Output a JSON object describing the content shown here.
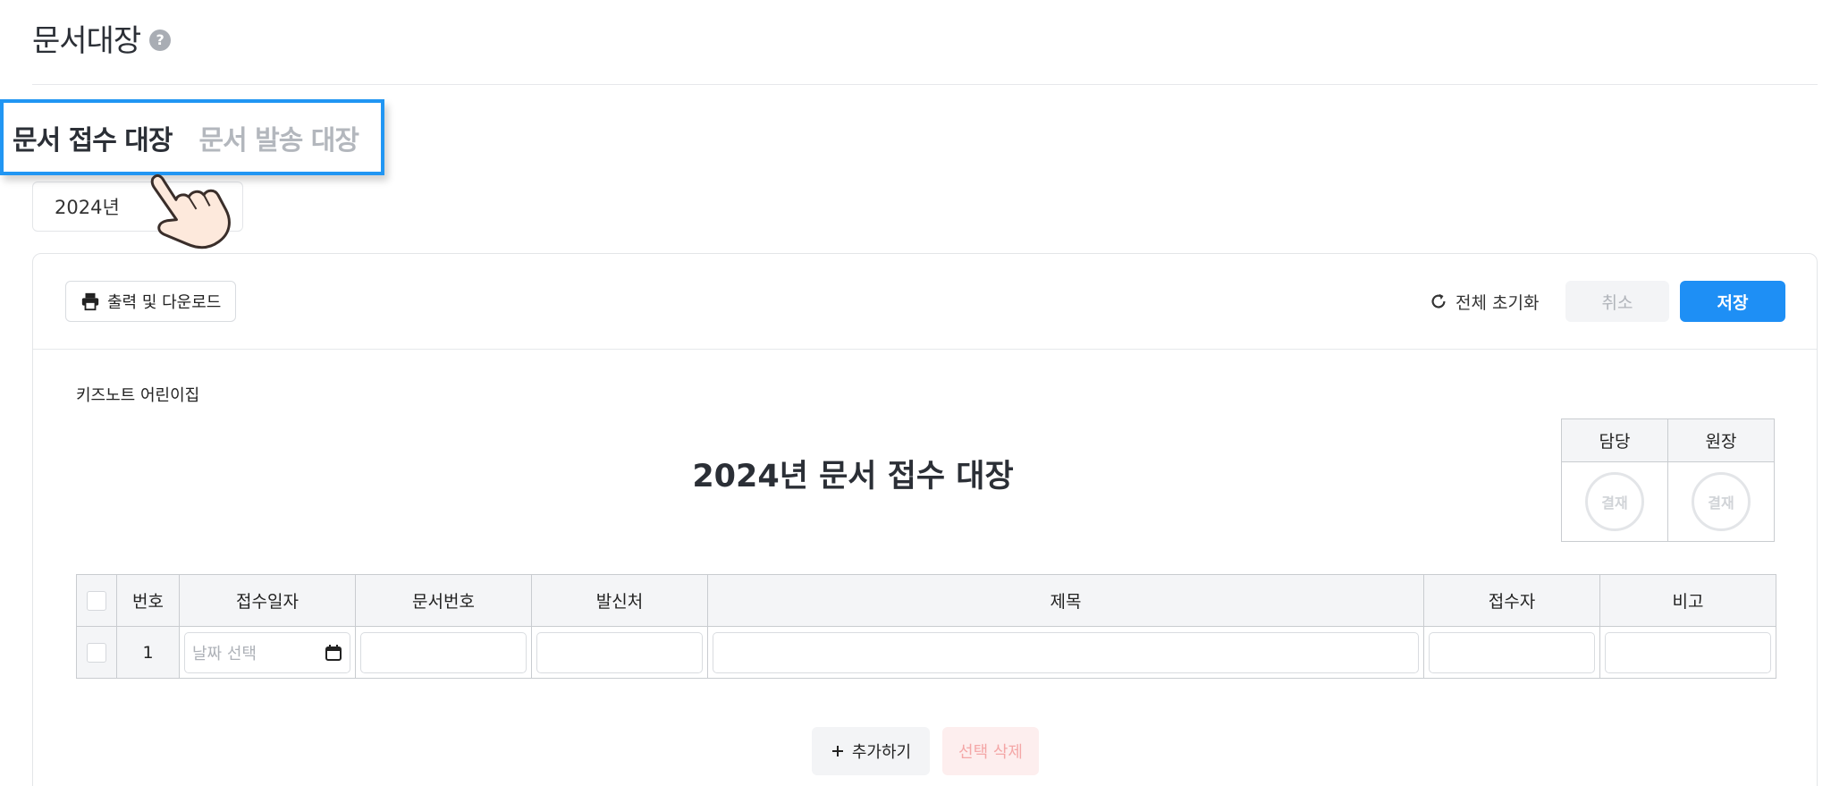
{
  "header": {
    "title": "문서대장",
    "help_icon": "question-circle-icon"
  },
  "tabs": [
    {
      "label": "문서 접수 대장",
      "active": true
    },
    {
      "label": "문서 발송 대장",
      "active": false
    }
  ],
  "year_select": {
    "value": "2024년"
  },
  "toolbar": {
    "print_label": "출력 및 다운로드",
    "reset_label": "전체 초기화",
    "cancel_label": "취소",
    "save_label": "저장"
  },
  "document": {
    "org_name": "키즈노트 어린이집",
    "title": "2024년 문서 접수 대장"
  },
  "approval": {
    "columns": [
      "담당",
      "원장"
    ],
    "stamp_label": "결재"
  },
  "table": {
    "headers": [
      "번호",
      "접수일자",
      "문서번호",
      "발신처",
      "제목",
      "접수자",
      "비고"
    ],
    "rows": [
      {
        "number": "1",
        "date_placeholder": "날짜 선택"
      }
    ]
  },
  "actions": {
    "add_label": "추가하기",
    "delete_label": "선택 삭제"
  },
  "colors": {
    "accent": "#1e8ff5",
    "highlight_border": "#2196f3",
    "danger_text": "#f4a7a7"
  }
}
